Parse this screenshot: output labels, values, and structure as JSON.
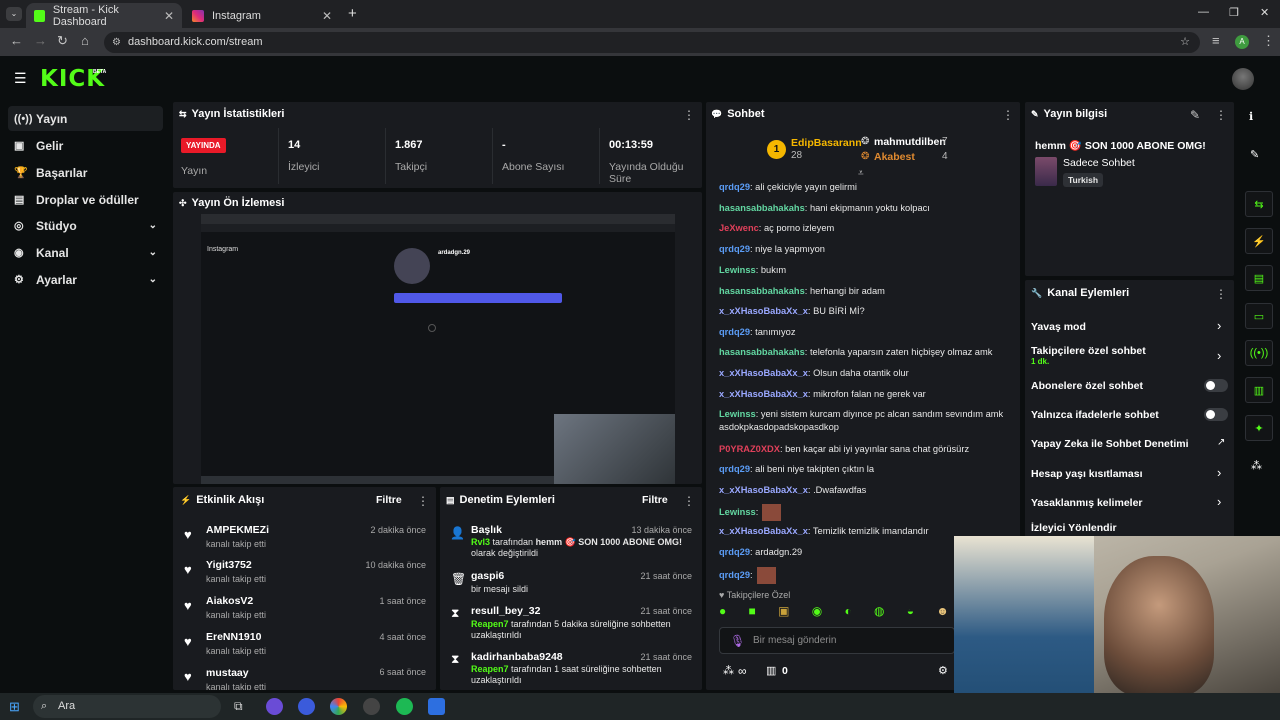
{
  "browser": {
    "tabs": [
      {
        "label": "Stream - Kick Dashboard",
        "favicon": "kick-icon",
        "color": "#53fc18"
      },
      {
        "label": "Instagram",
        "favicon": "instagram-icon",
        "color": "#e1306c"
      }
    ],
    "url": "dashboard.kick.com/stream",
    "profile_initial": "A"
  },
  "kick": {
    "logo": "KICK",
    "beta": "BETA"
  },
  "sidebar": {
    "items": [
      {
        "label": "Yayın",
        "icon": "broadcast-icon"
      },
      {
        "label": "Gelir",
        "icon": "revenue-icon"
      },
      {
        "label": "Başarılar",
        "icon": "trophy-icon"
      },
      {
        "label": "Droplar ve ödüller",
        "icon": "drops-icon"
      },
      {
        "label": "Stüdyo",
        "icon": "studio-icon"
      },
      {
        "label": "Kanal",
        "icon": "channel-icon"
      },
      {
        "label": "Ayarlar",
        "icon": "settings-icon"
      }
    ]
  },
  "stats": {
    "title": "Yayın İstatistikleri",
    "live_badge": "YAYINDA",
    "live_label": "Yayın",
    "items": [
      {
        "value": "14",
        "label": "İzleyici"
      },
      {
        "value": "1.867",
        "label": "Takipçi"
      },
      {
        "value": "-",
        "label": "Abone Sayısı"
      },
      {
        "value": "00:13:59",
        "label": "Yayında Olduğu Süre"
      }
    ]
  },
  "preview": {
    "title": "Yayın Ön İzlemesi",
    "ig_user": "ardadgn.29"
  },
  "activity": {
    "title": "Etkinlik Akışı",
    "filter": "Filtre",
    "items": [
      {
        "name": "AMPEKMEZi",
        "sub": "kanalı takip etti",
        "time": "2 dakika önce"
      },
      {
        "name": "Yigit3752",
        "sub": "kanalı takip etti",
        "time": "10 dakika önce"
      },
      {
        "name": "AiakosV2",
        "sub": "kanalı takip etti",
        "time": "1 saat önce"
      },
      {
        "name": "EreNN1910",
        "sub": "kanalı takip etti",
        "time": "4 saat önce"
      },
      {
        "name": "mustaay",
        "sub": "kanalı takip etti",
        "time": "6 saat önce"
      }
    ]
  },
  "moderation": {
    "title": "Denetim Eylemleri",
    "filter": "Filtre",
    "items": [
      {
        "name": "Başlık",
        "actor": "Rvl3",
        "text": " tarafından ",
        "target": "hemm 🎯 SON 1000 ABONE OMG!",
        "tail": " olarak değiştirildi",
        "time": "13 dakika önce"
      },
      {
        "name": "gaspi6",
        "actor": "",
        "text": "bir mesajı sildi",
        "target": "",
        "tail": "",
        "time": "21 saat önce"
      },
      {
        "name": "resull_bey_32",
        "actor": "Reapen7",
        "text": " tarafından 5 dakika süreliğine sohbetten uzaklaştırıldı",
        "target": "",
        "tail": "",
        "time": "21 saat önce"
      },
      {
        "name": "kadirhanbaba9248",
        "actor": "Reapen7",
        "text": " tarafından 1 saat süreliğine sohbetten uzaklaştırıldı",
        "target": "",
        "tail": "",
        "time": "21 saat önce"
      }
    ]
  },
  "chat": {
    "title": "Sohbet",
    "leaders": [
      {
        "rank": "1",
        "name": "EdipBasarann",
        "count": "28"
      },
      {
        "name": "mahmutdilben",
        "count": "7"
      },
      {
        "name": "Akabest",
        "count": "4"
      }
    ],
    "messages": [
      {
        "user": "qrdq29",
        "color": "#5b9cf5",
        "text": ": ali çekiciyle yayın gelirmi"
      },
      {
        "user": "hasansabbahakahs",
        "color": "#62d6a1",
        "text": ": hani ekipmanın yoktu kolpacı"
      },
      {
        "user": "JeXwenc",
        "color": "#e0405a",
        "text": ": aç porno izleyem"
      },
      {
        "user": "qrdq29",
        "color": "#5b9cf5",
        "text": ": niye la yapmıyon"
      },
      {
        "user": "Lewinss",
        "color": "#62d6a1",
        "text": ": bukım"
      },
      {
        "user": "hasansabbahakahs",
        "color": "#62d6a1",
        "text": ": herhangi bir adam"
      },
      {
        "user": "x_xXHasoBabaXx_x",
        "color": "#9aa8ff",
        "text": ": BU BİRİ Mİ?"
      },
      {
        "user": "qrdq29",
        "color": "#5b9cf5",
        "text": ": tanımıyoz"
      },
      {
        "user": "hasansabbahakahs",
        "color": "#62d6a1",
        "text": ": telefonla yaparsın zaten hiçbişey olmaz amk"
      },
      {
        "user": "x_xXHasoBabaXx_x",
        "color": "#9aa8ff",
        "text": ": Olsun daha otantik olur"
      },
      {
        "user": "x_xXHasoBabaXx_x",
        "color": "#9aa8ff",
        "text": ": mikrofon falan ne gerek var"
      },
      {
        "user": "Lewinss",
        "color": "#62d6a1",
        "text": ": yeni sistem kurcam diyınce pc alcan sandım sevındım amk asdokpkasdopadskopasdkop"
      },
      {
        "user": "P0YRAZ0XDX",
        "color": "#e0405a",
        "text": ": ben kaçar abi iyi yayınlar sana chat görüsürz"
      },
      {
        "user": "qrdq29",
        "color": "#5b9cf5",
        "text": ": ali beni niye takipten çıktın la"
      },
      {
        "user": "x_xXHasoBabaXx_x",
        "color": "#9aa8ff",
        "text": ": .Dwafawdfas"
      },
      {
        "user": "Lewinss",
        "color": "#62d6a1",
        "text": ":"
      },
      {
        "user": "x_xXHasoBabaXx_x",
        "color": "#9aa8ff",
        "text": ": Temizlik temizlik imandandır"
      },
      {
        "user": "qrdq29",
        "color": "#5b9cf5",
        "text": ": ardadgn.29"
      },
      {
        "user": "qrdq29",
        "color": "#5b9cf5",
        "text": ":"
      }
    ],
    "followers_only": "Takipçilere Özel",
    "placeholder": "Bir mesaj gönderin",
    "points": "∞",
    "gift_count": "0"
  },
  "stream_info": {
    "title": "Yayın bilgisi",
    "stream_title": "hemm 🎯 SON 1000 ABONE OMG!",
    "category": "Sadece Sohbet",
    "tag": "Turkish"
  },
  "channel_actions": {
    "title": "Kanal Eylemleri",
    "items": [
      {
        "label": "Yavaş mod",
        "sub": "",
        "control": "arrow"
      },
      {
        "label": "Takipçilere özel sohbet",
        "sub": "1 dk.",
        "control": "arrow"
      },
      {
        "label": "Abonelere özel sohbet",
        "sub": "",
        "control": "toggle"
      },
      {
        "label": "Yalnızca ifadelerle sohbet",
        "sub": "",
        "control": "toggle"
      },
      {
        "label": "Yapay Zeka ile Sohbet Denetimi",
        "sub": "",
        "control": "external"
      },
      {
        "label": "Hesap yaşı kısıtlaması",
        "sub": "",
        "control": "arrow"
      },
      {
        "label": "Yasaklanmış kelimeler",
        "sub": "",
        "control": "arrow"
      },
      {
        "label": "İzleyici Yönlendir",
        "sub": "",
        "control": "none"
      }
    ]
  },
  "taskbar": {
    "search": "Ara"
  }
}
